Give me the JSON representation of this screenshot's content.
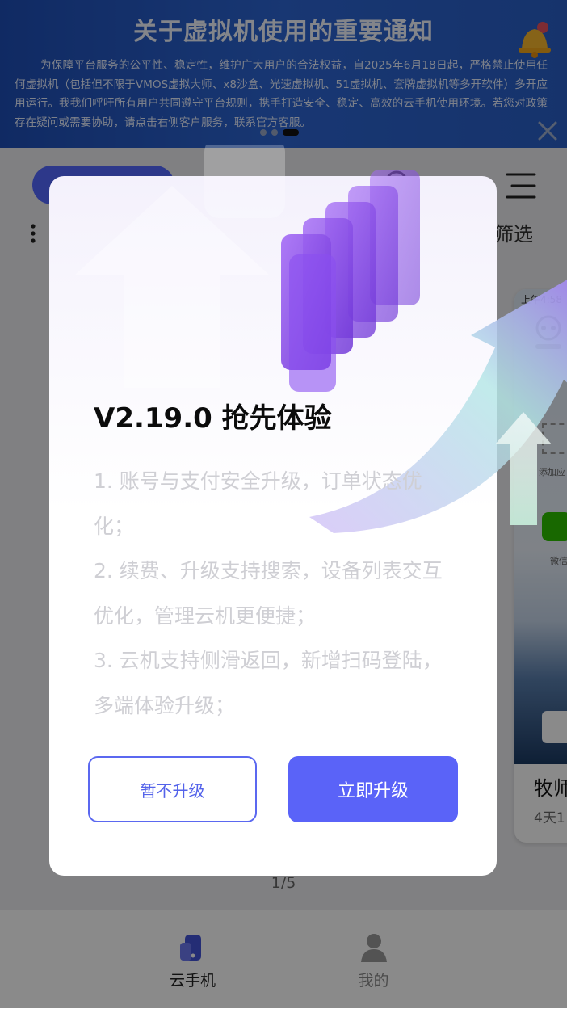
{
  "banner": {
    "title": "关于虚拟机使用的重要通知",
    "text": "为保障平台服务的公平性、稳定性，维护广大用户的合法权益，自2025年6月18日起，严格禁止使用任何虚拟机（包括但不限于VMOS虚拟大师、x8沙盒、光速虚拟机、51虚拟机、套牌虚拟机等多开软件）多开应用运行。我我们呼吁所有用户共同遵守平台规则，携手打造安全、稳定、高效的云手机使用环境。若您对政策存在疑问或需要协助，请点击右侧客户服务，联系官方客服。",
    "carousel_active_index": 2,
    "carousel_count": 3
  },
  "background": {
    "filter_label": "筛选",
    "pager": "1/5",
    "phone_card": {
      "time": "上午4:58",
      "add_label": "添加应",
      "wechat_label": "微信",
      "name": "牧师",
      "subtitle": "4天1"
    }
  },
  "tabbar": {
    "tabs": [
      {
        "label": "云手机",
        "icon": "phone-icon",
        "active": true
      },
      {
        "label": "我的",
        "icon": "user-icon",
        "active": false
      }
    ]
  },
  "modal": {
    "title": "V2.19.0 抢先体验",
    "notes": [
      "1. 账号与支付安全升级，订单状态优化；",
      "2. 续费、升级支持搜索，设备列表交互优化，管理云机更便捷；",
      "3. 云机支持侧滑返回，新增扫码登陆，多端体验升级；"
    ],
    "later_label": "暂不升级",
    "upgrade_label": "立即升级"
  },
  "colors": {
    "accent": "#5a63f8",
    "banner": "#2d66d4",
    "overlay": "rgba(0,0,0,0.46)"
  }
}
